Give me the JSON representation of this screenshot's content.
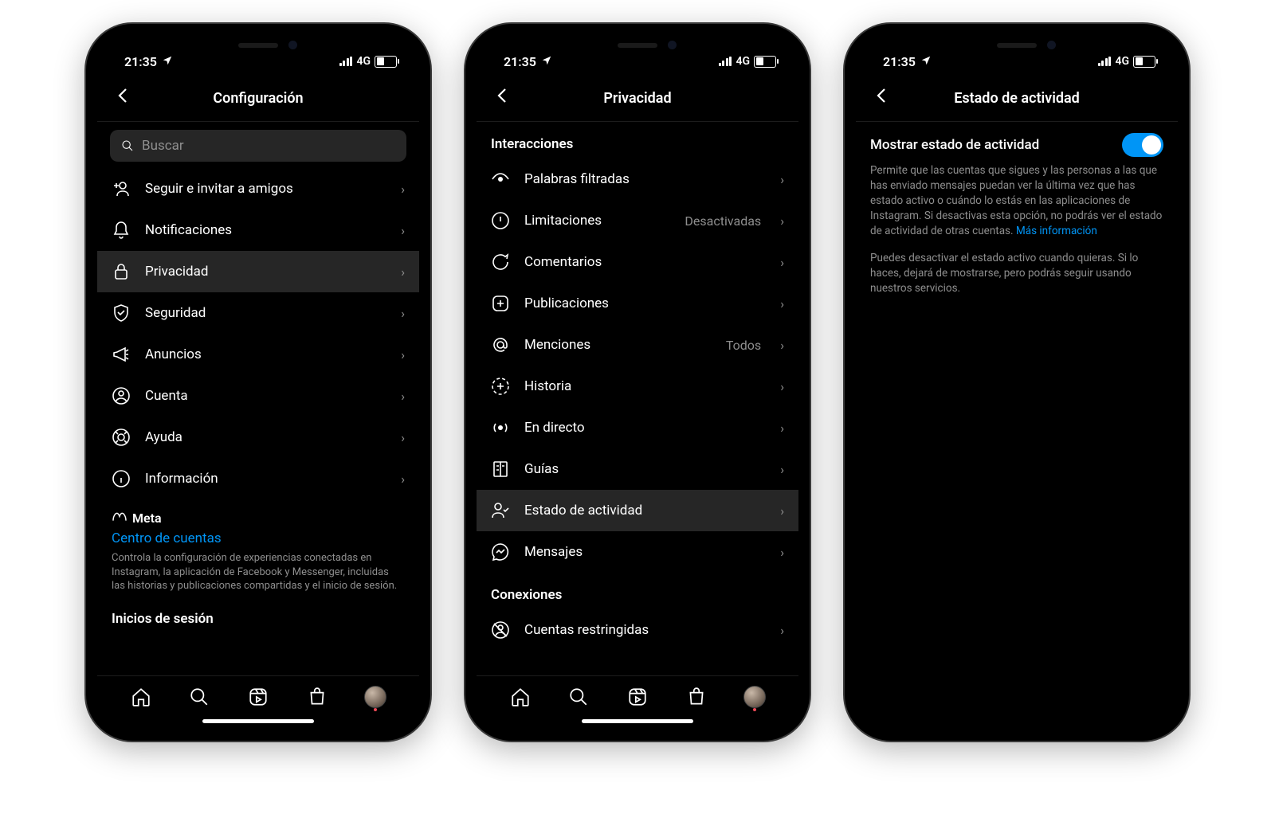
{
  "status": {
    "time": "21:35",
    "network": "4G"
  },
  "phone1": {
    "title": "Configuración",
    "search_placeholder": "Buscar",
    "items": [
      {
        "icon": "user-plus-icon",
        "label": "Seguir e invitar a amigos"
      },
      {
        "icon": "bell-icon",
        "label": "Notificaciones"
      },
      {
        "icon": "lock-icon",
        "label": "Privacidad",
        "highlight": true
      },
      {
        "icon": "shield-icon",
        "label": "Seguridad"
      },
      {
        "icon": "megaphone-icon",
        "label": "Anuncios"
      },
      {
        "icon": "user-circle-icon",
        "label": "Cuenta"
      },
      {
        "icon": "lifebuoy-icon",
        "label": "Ayuda"
      },
      {
        "icon": "info-icon",
        "label": "Información"
      }
    ],
    "meta": {
      "brand": "Meta",
      "link": "Centro de cuentas",
      "desc": "Controla la configuración de experiencias conectadas en Instagram, la aplicación de Facebook y Messenger, incluidas las historias y publicaciones compartidas y el inicio de sesión."
    },
    "logins_title": "Inicios de sesión"
  },
  "phone2": {
    "title": "Privacidad",
    "section1": "Interacciones",
    "items": [
      {
        "icon": "eye-hidden-icon",
        "label": "Palabras filtradas"
      },
      {
        "icon": "alert-circle-icon",
        "label": "Limitaciones",
        "value": "Desactivadas"
      },
      {
        "icon": "comment-icon",
        "label": "Comentarios"
      },
      {
        "icon": "plus-square-icon",
        "label": "Publicaciones"
      },
      {
        "icon": "at-icon",
        "label": "Menciones",
        "value": "Todos"
      },
      {
        "icon": "story-add-icon",
        "label": "Historia"
      },
      {
        "icon": "live-icon",
        "label": "En directo"
      },
      {
        "icon": "guides-icon",
        "label": "Guías"
      },
      {
        "icon": "activity-status-icon",
        "label": "Estado de actividad",
        "highlight": true
      },
      {
        "icon": "messenger-icon",
        "label": "Mensajes"
      }
    ],
    "section2": "Conexiones",
    "items2": [
      {
        "icon": "restricted-icon",
        "label": "Cuentas restringidas"
      }
    ]
  },
  "phone3": {
    "title": "Estado de actividad",
    "toggle_label": "Mostrar estado de actividad",
    "desc1": "Permite que las cuentas que sigues y las personas a las que has enviado mensajes puedan ver la última vez que has estado activo o cuándo lo estás en las aplicaciones de Instagram. Si desactivas esta opción, no podrás ver el estado de actividad de otras cuentas.",
    "link": "Más información",
    "desc2": "Puedes desactivar el estado activo cuando quieras. Si lo haces, dejará de mostrarse, pero podrás seguir usando nuestros servicios."
  }
}
